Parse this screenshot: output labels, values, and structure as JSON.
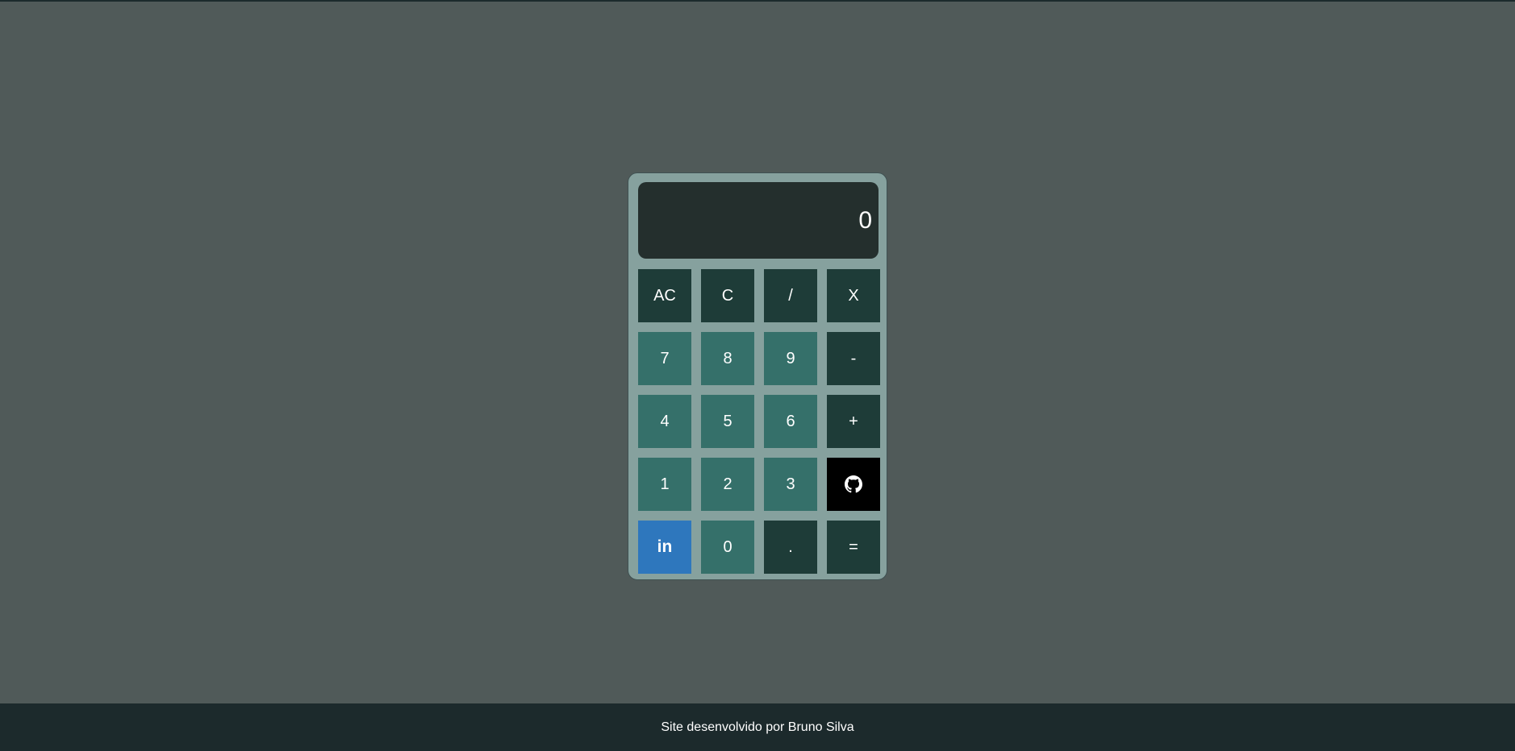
{
  "calculator": {
    "display_value": "0",
    "keys": {
      "ac": "AC",
      "c": "C",
      "divide": "/",
      "multiply": "X",
      "seven": "7",
      "eight": "8",
      "nine": "9",
      "minus": "-",
      "four": "4",
      "five": "5",
      "six": "6",
      "plus": "+",
      "one": "1",
      "two": "2",
      "three": "3",
      "github_icon": "github-icon",
      "linkedin": "in",
      "zero": "0",
      "dot": ".",
      "equals": "="
    }
  },
  "footer": {
    "text": "Site desenvolvido por Bruno Silva"
  },
  "colors": {
    "background": "#505a59",
    "body": "#86a19e",
    "display": "#242f2d",
    "operator_key": "#1e3c38",
    "number_key": "#35706a",
    "github_key": "#000000",
    "linkedin_key": "#2e77bd",
    "footer": "#1c2a2c"
  }
}
